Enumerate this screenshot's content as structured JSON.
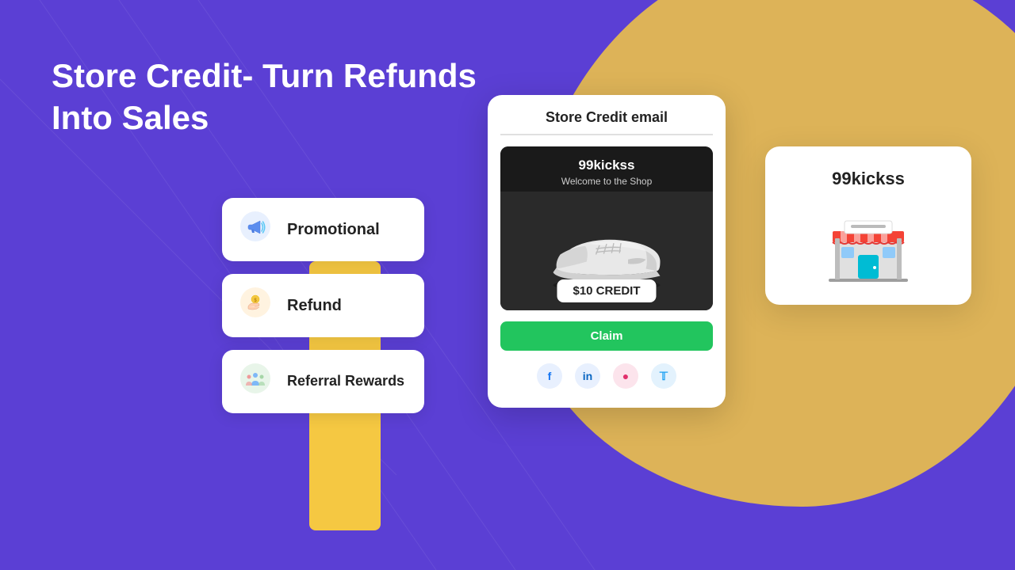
{
  "hero": {
    "title_line1": "Store Credit- Turn Refunds",
    "title_line2": "Into Sales"
  },
  "cards": [
    {
      "id": "promotional",
      "label": "Promotional",
      "icon": "📣"
    },
    {
      "id": "refund",
      "label": "Refund",
      "icon": "🤲"
    },
    {
      "id": "referral",
      "label": "Referral Rewards",
      "icon": "👥"
    }
  ],
  "email_card": {
    "title": "Store Credit email",
    "shop_name": "99kickss",
    "shop_subtitle": "Welcome to the Shop",
    "credit_amount": "$10 CREDIT",
    "claim_button": "Claim",
    "social": [
      "f",
      "in",
      "ig",
      "tw"
    ]
  },
  "store_card": {
    "name": "99kickss"
  }
}
